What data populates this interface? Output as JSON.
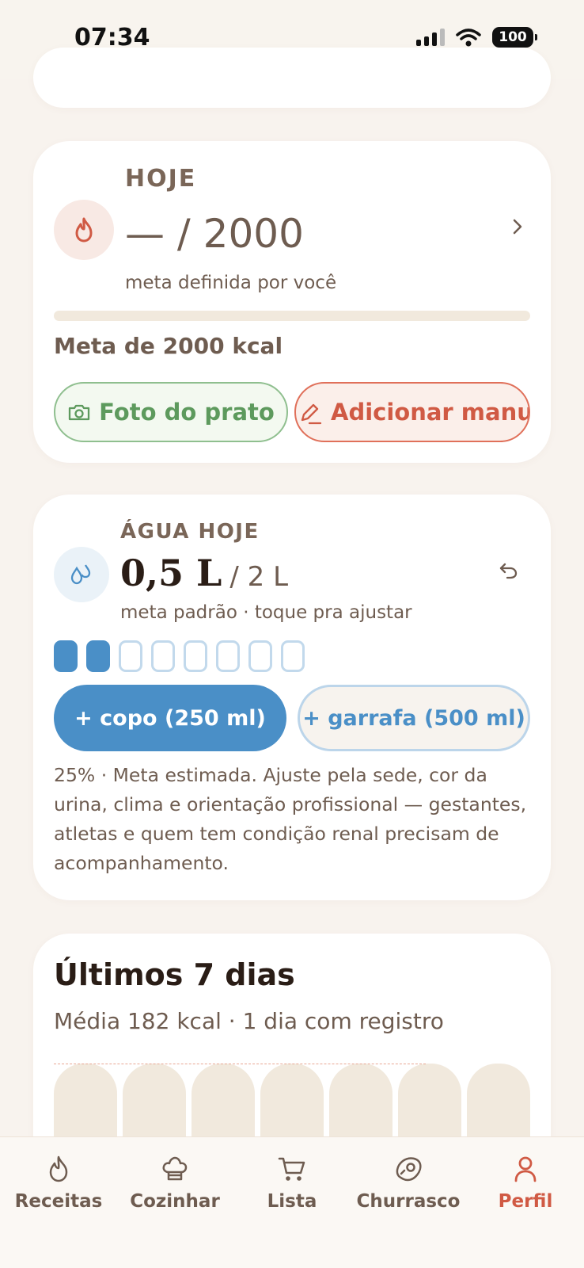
{
  "status_bar": {
    "time": "07:34",
    "battery": "100"
  },
  "calories": {
    "label": "HOJE",
    "value": "— / 2000",
    "subtitle": "meta definida por você",
    "progress": 0,
    "goal_text": "Meta de 2000 kcal",
    "photo_button": "Foto do prato",
    "manual_button": "Adicionar manual"
  },
  "water": {
    "label": "ÁGUA HOJE",
    "amount": "0,5 L",
    "goal": "/ 2 L",
    "subtitle": "meta padrão · toque pra ajustar",
    "cups_filled": 2,
    "cups_total": 8,
    "cup_button": "+ copo (250 ml)",
    "bottle_button": "+ garrafa (500 ml)",
    "note": "25% · Meta estimada. Ajuste pela sede, cor da urina, clima e orientação profissional — gestantes, atletas e quem tem condição renal precisam de acompanhamento."
  },
  "week": {
    "title": "Últimos 7 dias",
    "subtitle": "Média 182 kcal · 1 dia com registro"
  },
  "tabs": [
    {
      "label": "Receitas",
      "icon": "flame-icon"
    },
    {
      "label": "Cozinhar",
      "icon": "chef-hat-icon"
    },
    {
      "label": "Lista",
      "icon": "cart-icon"
    },
    {
      "label": "Churrasco",
      "icon": "steak-icon"
    },
    {
      "label": "Perfil",
      "icon": "person-icon",
      "active": true
    }
  ],
  "colors": {
    "accent": "#d05a44",
    "water_blue": "#4a8fc7",
    "green": "#5d9a5d",
    "background": "#f8f3ee"
  }
}
